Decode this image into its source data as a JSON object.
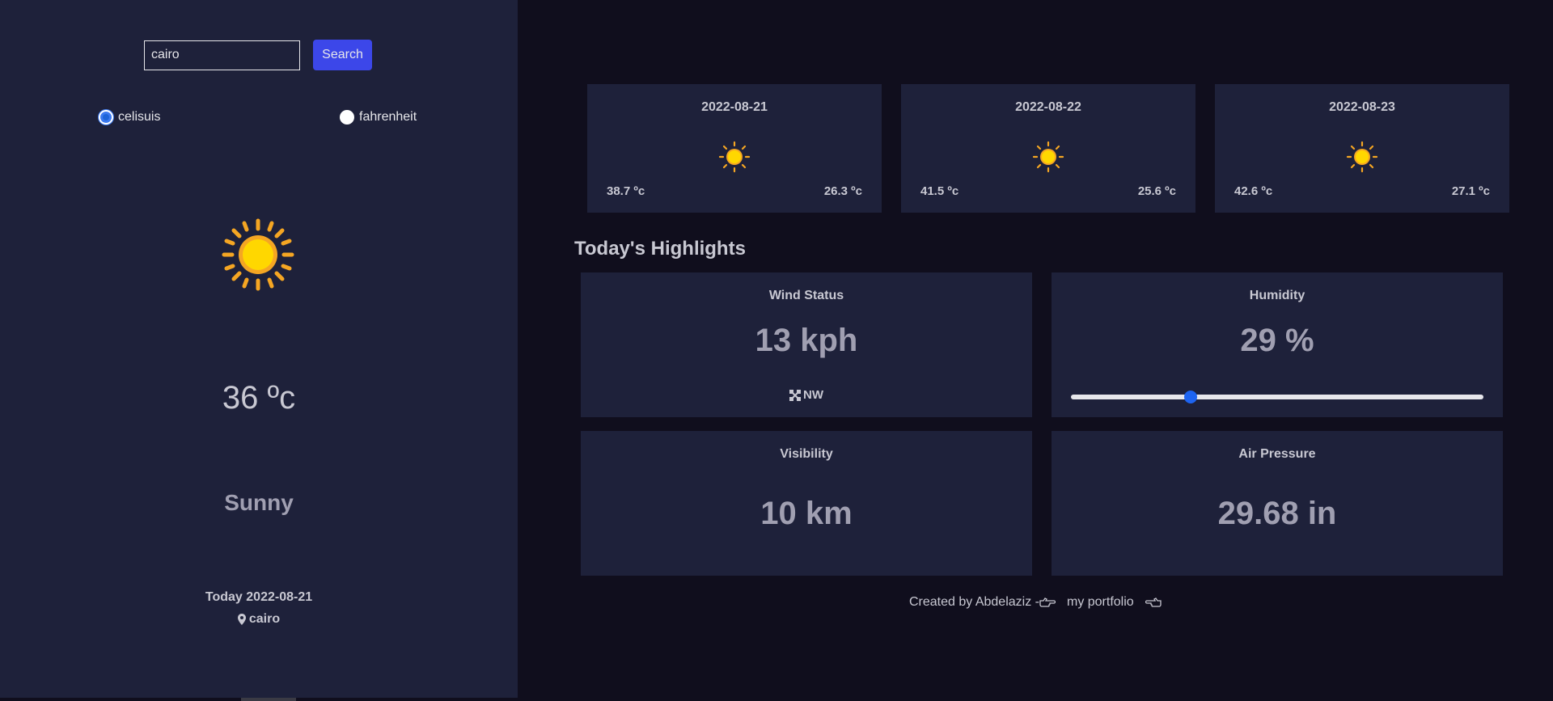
{
  "search": {
    "value": "cairo",
    "button_label": "Search"
  },
  "units": [
    {
      "label": "celisuis",
      "checked": true
    },
    {
      "label": "fahrenheit",
      "checked": false
    }
  ],
  "current": {
    "icon": "sun-icon",
    "temperature": "36 ºc",
    "condition": "Sunny",
    "date_line": "Today 2022-08-21",
    "location": "cairo"
  },
  "forecast": [
    {
      "date": "2022-08-21",
      "icon": "sun-icon",
      "max": "38.7 ºc",
      "min": "26.3 ºc"
    },
    {
      "date": "2022-08-22",
      "icon": "sun-icon",
      "max": "41.5 ºc",
      "min": "25.6 ºc"
    },
    {
      "date": "2022-08-23",
      "icon": "sun-icon",
      "max": "42.6 ºc",
      "min": "27.1 ºc"
    }
  ],
  "highlights": {
    "title": "Today's Highlights",
    "wind": {
      "label": "Wind Status",
      "value": "13 kph",
      "direction": "NW"
    },
    "humidity": {
      "label": "Humidity",
      "value": "29 %",
      "percent": 29
    },
    "visibility": {
      "label": "Visibility",
      "value": "10 km"
    },
    "pressure": {
      "label": "Air Pressure",
      "value": "29.68 in"
    }
  },
  "footer": {
    "credit": "Created by Abdelaziz -",
    "link": "my portfolio"
  },
  "colors": {
    "sun": "#ffd700",
    "sun_rays": "#f5a623",
    "accent": "#3c47e9",
    "panel": "#1e213a",
    "background": "#100e1d"
  }
}
